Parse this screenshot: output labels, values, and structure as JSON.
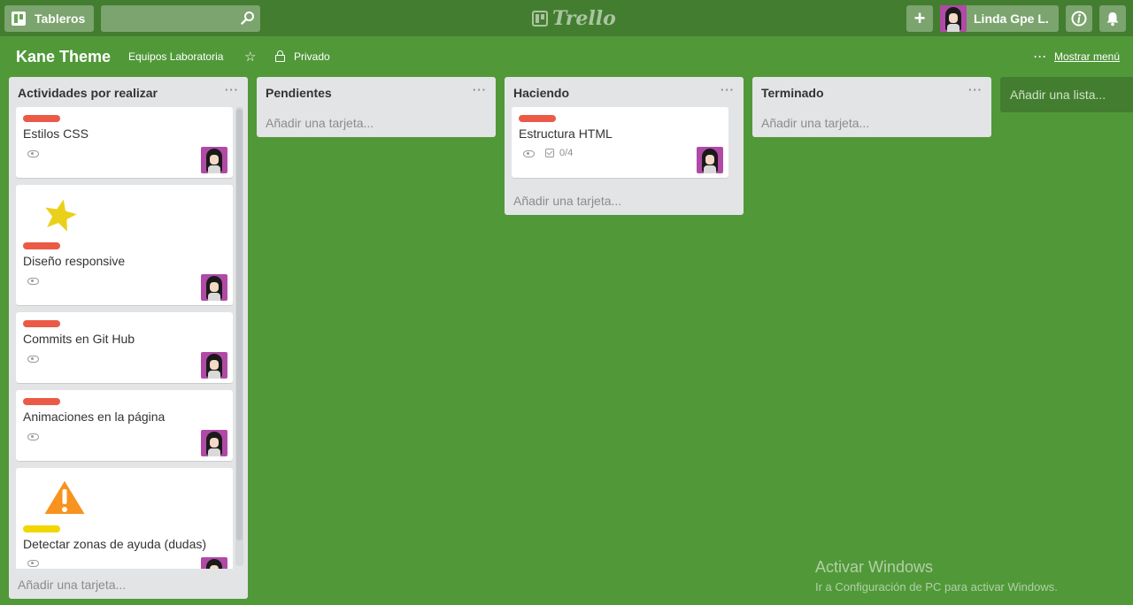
{
  "header": {
    "boards_label": "Tableros",
    "search": {
      "value": "",
      "placeholder": ""
    },
    "logo_text": "Trello",
    "user_name": "Linda Gpe L."
  },
  "board": {
    "title": "Kane Theme",
    "team": "Equipos Laboratoria",
    "privacy": "Privado",
    "menu_label": "Mostrar menú"
  },
  "lists": [
    {
      "title": "Actividades por realizar",
      "cards": [
        {
          "title": "Estilos CSS",
          "label_color": "#eb5a46"
        },
        {
          "title": "Diseño responsive",
          "label_color": "#eb5a46",
          "cover_icon": "star-icon"
        },
        {
          "title": "Commits en Git Hub",
          "label_color": "#eb5a46"
        },
        {
          "title": "Animaciones en la página",
          "label_color": "#eb5a46"
        },
        {
          "title": "Detectar zonas de ayuda (dudas)",
          "label_color": "#f2d600",
          "cover_icon": "warning-icon"
        }
      ],
      "add_card": "Añadir una tarjeta..."
    },
    {
      "title": "Pendientes",
      "cards": [],
      "add_card": "Añadir una tarjeta..."
    },
    {
      "title": "Haciendo",
      "cards": [
        {
          "title": "Estructura HTML",
          "label_color": "#eb5a46",
          "checklist": "0/4"
        }
      ],
      "add_card": "Añadir una tarjeta..."
    },
    {
      "title": "Terminado",
      "cards": [],
      "add_card": "Añadir una tarjeta..."
    }
  ],
  "add_list": "Añadir una lista...",
  "watermark": {
    "title": "Activar Windows",
    "subtitle": "Ir a Configuración de PC para activar Windows."
  },
  "colors": {
    "background": "#519839",
    "header": "#437d30",
    "list": "#e2e4e6",
    "label_red": "#eb5a46",
    "label_yellow": "#f2d600"
  }
}
